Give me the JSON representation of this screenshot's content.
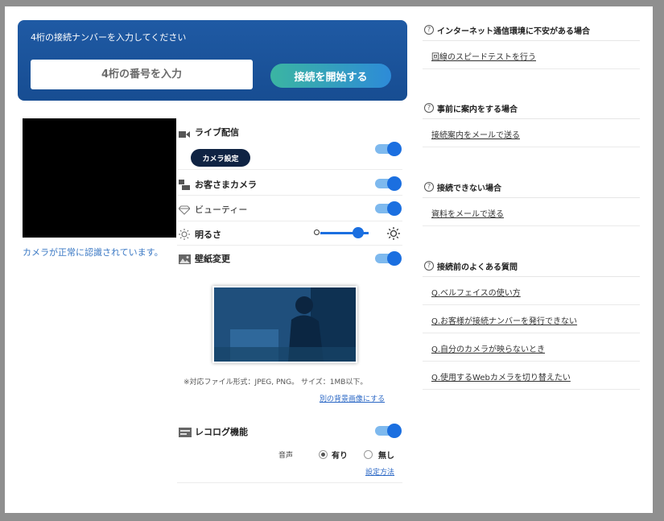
{
  "connect": {
    "title": "4桁の接続ナンバーを入力してください",
    "input_placeholder": "4桁の番号を入力",
    "start_button": "接続を開始する"
  },
  "camera": {
    "status_text": "カメラが正常に認識されています。"
  },
  "settings": {
    "live": {
      "label": "ライブ配信",
      "enabled": true,
      "camera_settings_button": "カメラ設定"
    },
    "customer_camera": {
      "label": "お客さまカメラ",
      "enabled": true
    },
    "beauty": {
      "label": "ビューティー",
      "enabled": true
    },
    "brightness": {
      "label": "明るさ",
      "level_fraction": 0.75
    },
    "wallpaper": {
      "label": "壁紙変更",
      "enabled": true,
      "file_note": "※対応ファイル形式：JPEG, PNG。 サイズ：1MB以下。",
      "change_link": "別の背景画像にする"
    },
    "recolog": {
      "label": "レコログ機能",
      "enabled": true,
      "audio_label": "音声",
      "option_on": "有り",
      "option_off": "無し",
      "selected": "有り",
      "setup_link": "設定方法"
    }
  },
  "help": {
    "sections": [
      {
        "heading": "インターネット通信環境に不安がある場合",
        "links": [
          "回線のスピードテストを行う"
        ]
      },
      {
        "heading": "事前に案内をする場合",
        "links": [
          "接続案内をメールで送る"
        ]
      },
      {
        "heading": "接続できない場合",
        "links": [
          "資料をメールで送る"
        ]
      },
      {
        "heading": "接続前のよくある質問",
        "links": [
          "Q.ベルフェイスの使い方",
          "Q.お客様が接続ナンバーを発行できない",
          "Q.自分のカメラが映らないとき",
          "Q.使用するWebカメラを切り替えたい"
        ]
      }
    ]
  },
  "colors": {
    "panel": "#1f5aa4",
    "accent": "#1b6fe0",
    "link": "#2a67c5"
  }
}
